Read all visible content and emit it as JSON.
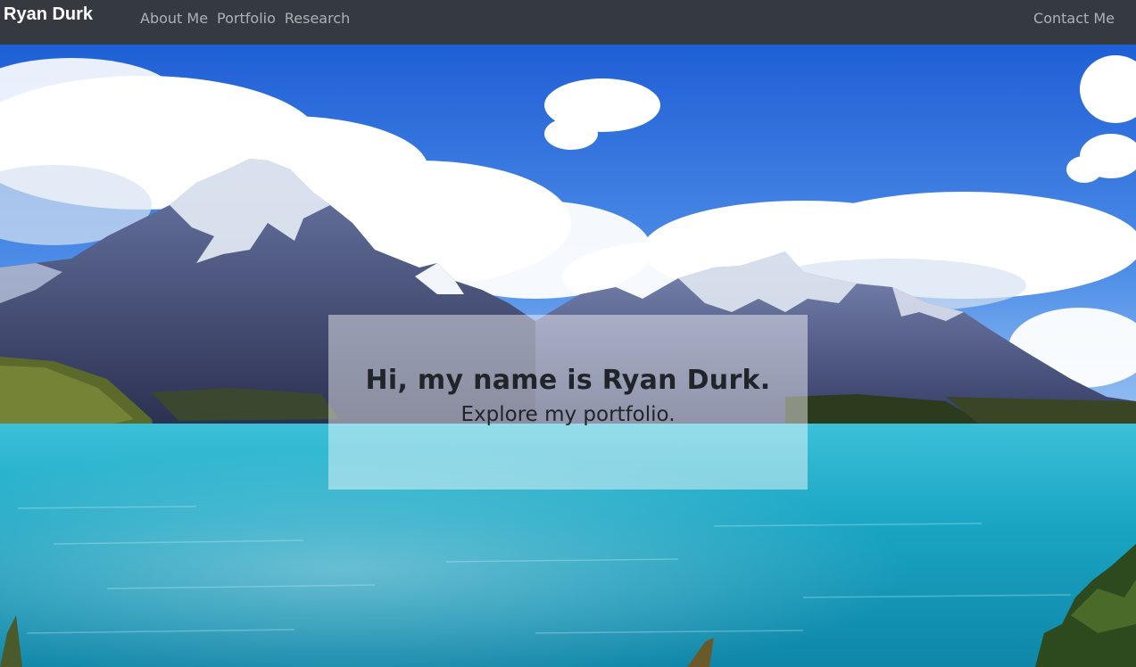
{
  "navbar": {
    "brand": "Ryan Durk",
    "links": [
      {
        "label": "About Me"
      },
      {
        "label": "Portfolio"
      },
      {
        "label": "Research"
      }
    ],
    "contact_label": "Contact Me",
    "background_color": "#343a40"
  },
  "hero": {
    "title": "Hi, my name is Ryan Durk.",
    "subtitle": "Explore my portfolio."
  }
}
